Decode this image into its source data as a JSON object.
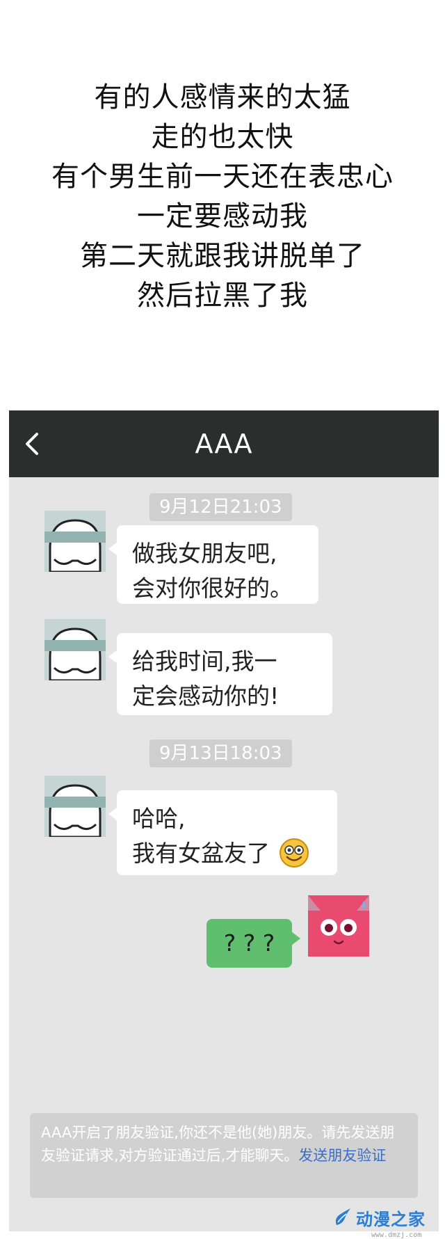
{
  "caption": {
    "lines": [
      "有的人感情来的太猛",
      "走的也太快",
      "有个男生前一天还在表忠心",
      "一定要感动我",
      "第二天就跟我讲脱单了",
      "然后拉黑了我"
    ]
  },
  "chat": {
    "title": "AAA",
    "back_icon": "chevron-left-icon",
    "timestamps": [
      "9月12日21:03",
      "9月13日18:03"
    ],
    "messages": [
      {
        "sender": "AAA",
        "lines": [
          "做我女朋友吧,",
          "会对你很好的。"
        ]
      },
      {
        "sender": "AAA",
        "lines": [
          "给我时间,我一",
          "定会感动你的!"
        ]
      },
      {
        "sender": "AAA",
        "lines": [
          "哈哈,",
          "我有女盆友了"
        ],
        "emoji": "smiley-face-icon"
      },
      {
        "sender": "me",
        "lines": [
          "? ? ?"
        ]
      }
    ],
    "notice": {
      "text": "AAA开启了朋友验证,你还不是他(她)朋友。请先发送朋友验证请求,对方验证通过后,才能聊天。",
      "link": "发送朋友验证"
    }
  },
  "watermark": {
    "text": "动漫之家",
    "url": "www.dmzj.com"
  },
  "colors": {
    "header_bg": "#2b2e2d",
    "chat_bg": "#e5e5e5",
    "bubble_incoming": "#ffffff",
    "bubble_outgoing": "#5fbf6e",
    "timestamp_bg": "#cfcfcf",
    "notice_link": "#3d6ec7",
    "avatar_stripe": "#93b3b0",
    "own_avatar": "#e94a6f"
  }
}
